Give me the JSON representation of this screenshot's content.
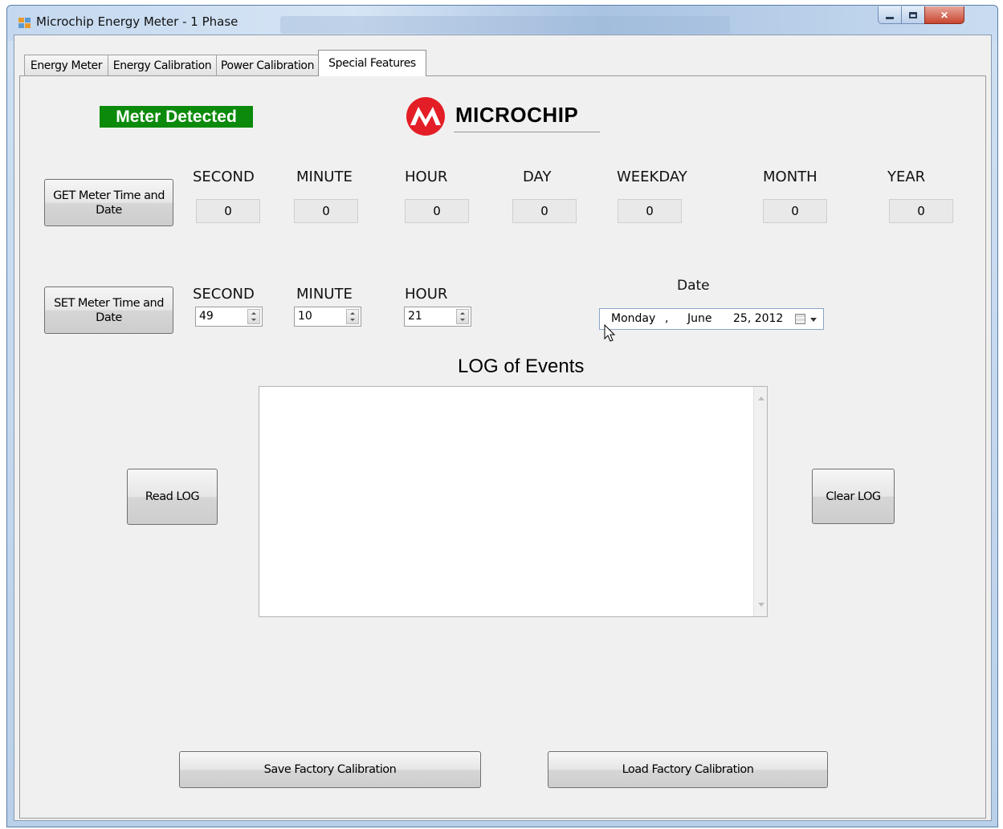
{
  "window": {
    "title": "Microchip Energy Meter - 1 Phase"
  },
  "tabs": [
    {
      "label": "Energy Meter"
    },
    {
      "label": "Energy Calibration"
    },
    {
      "label": "Power Calibration"
    },
    {
      "label": "Special Features",
      "active": true
    }
  ],
  "status": {
    "label": "Meter Detected",
    "color": "#0b8a0b"
  },
  "logo": {
    "text": "MICROCHIP",
    "color": "#e41e26"
  },
  "get_section": {
    "button_label": "GET Meter Time and Date",
    "fields": [
      {
        "label": "SECOND",
        "value": "0"
      },
      {
        "label": "MINUTE",
        "value": "0"
      },
      {
        "label": "HOUR",
        "value": "0"
      },
      {
        "label": "DAY",
        "value": "0"
      },
      {
        "label": "WEEKDAY",
        "value": "0"
      },
      {
        "label": "MONTH",
        "value": "0"
      },
      {
        "label": "YEAR",
        "value": "0"
      }
    ]
  },
  "set_section": {
    "button_label": "SET Meter Time and Date",
    "fields": [
      {
        "label": "SECOND",
        "value": "49"
      },
      {
        "label": "MINUTE",
        "value": "10"
      },
      {
        "label": "HOUR",
        "value": "21"
      }
    ],
    "date_label": "Date",
    "date": {
      "weekday": "Monday",
      "separator": ",",
      "month": "June",
      "day_year": "25, 2012"
    }
  },
  "log": {
    "title": "LOG of Events",
    "read_button": "Read LOG",
    "clear_button": "Clear LOG"
  },
  "factory": {
    "save_button": "Save Factory Calibration",
    "load_button": "Load Factory Calibration"
  },
  "icons": {
    "app": "app-window-icon",
    "calendar": "calendar-icon",
    "cursor": "mouse-pointer-icon"
  }
}
